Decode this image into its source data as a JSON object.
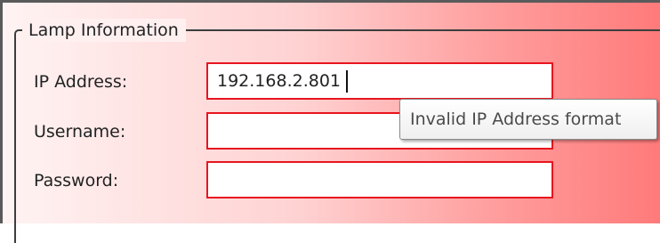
{
  "group": {
    "title": "Lamp Information"
  },
  "fields": {
    "ip_address": {
      "label": "IP Address:",
      "value": "192.168.2.801"
    },
    "username": {
      "label": "Username:",
      "value": ""
    },
    "password": {
      "label": "Password:",
      "value": ""
    }
  },
  "tooltip": {
    "text": "Invalid IP Address format"
  },
  "colors": {
    "error_border": "#e8151f",
    "panel_gradient_start": "#fff3f3",
    "panel_gradient_end": "#ff7a7a"
  }
}
